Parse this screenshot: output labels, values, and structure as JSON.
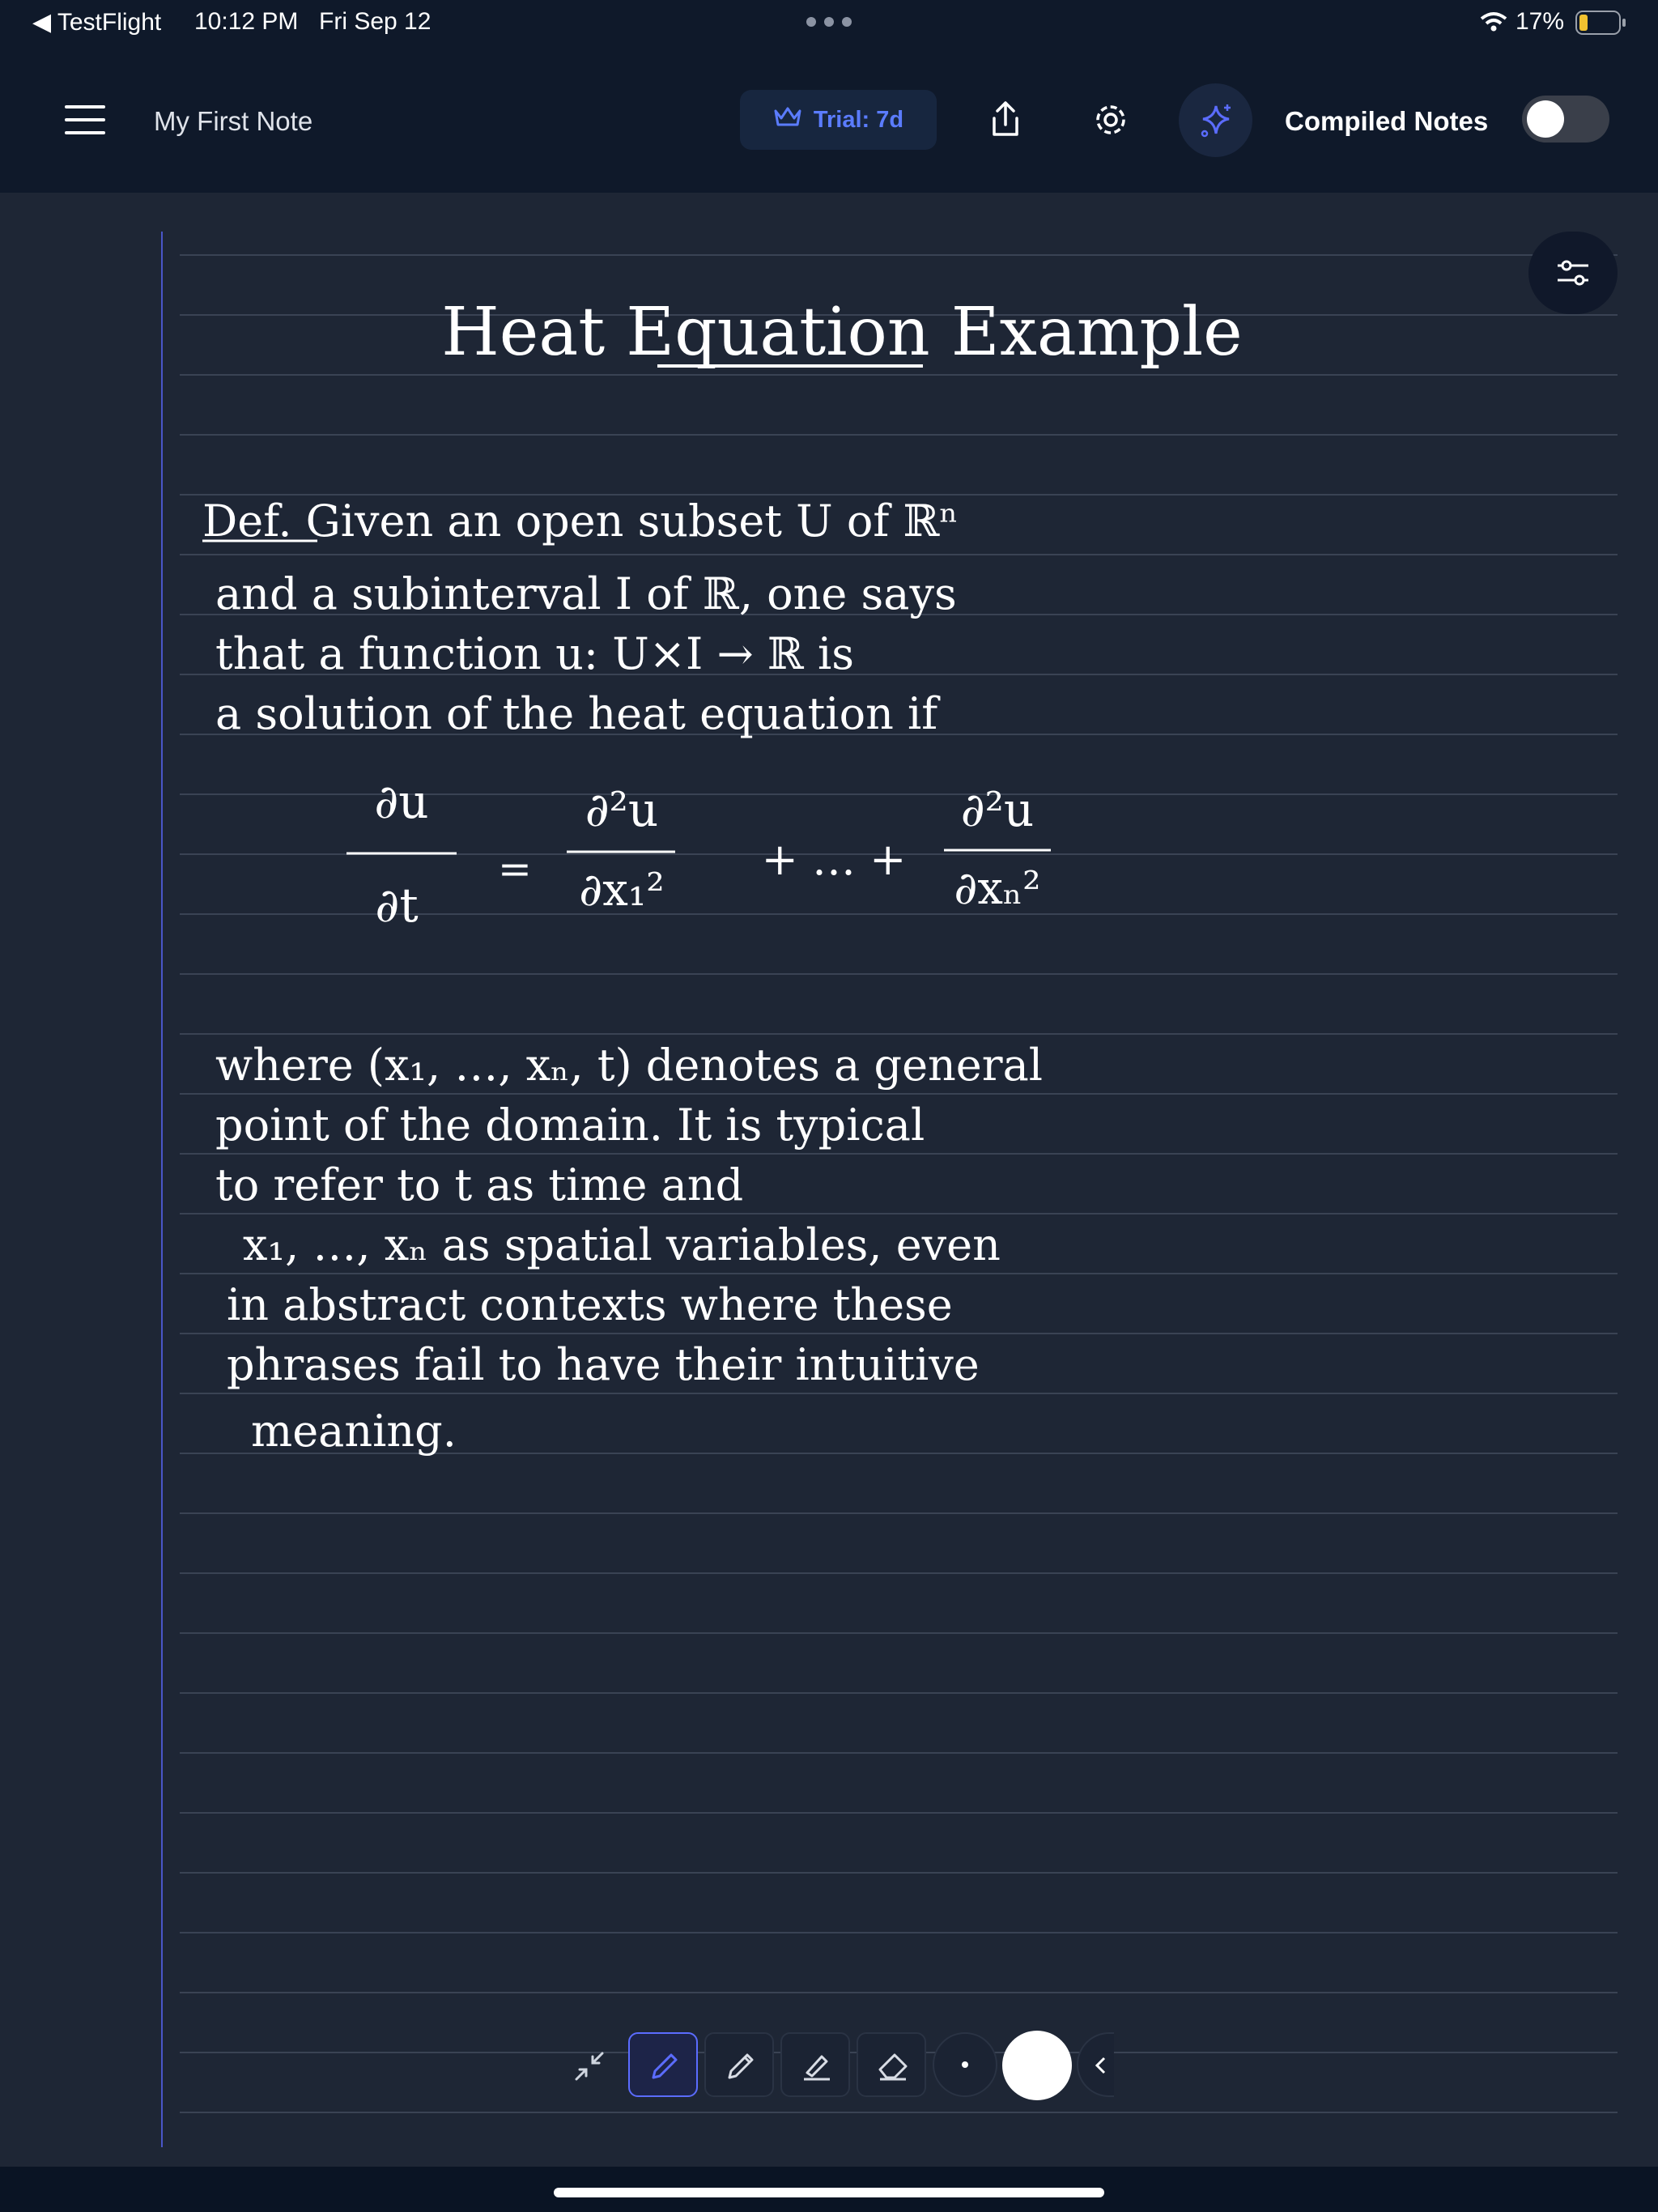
{
  "status_bar": {
    "back_app": "◀ TestFlight",
    "time": "10:12 PM",
    "date": "Fri Sep 12",
    "battery": "17%"
  },
  "header": {
    "note_title": "My First Note",
    "trial_label": "Trial: 7d",
    "compiled_label": "Compiled Notes",
    "compiled_enabled": false
  },
  "note": {
    "title": "Heat Equation Example",
    "lines": [
      "Def. Given an open subset U of ℝⁿ",
      "and a subinterval I of ℝ, one says",
      "that a function u: U×I → ℝ is",
      "a solution of the heat equation if",
      "where (x₁, …, xₙ, t) denotes a general",
      "point of the domain. It is typical",
      "to refer to t as time and",
      "x₁, …, xₙ as spatial variables, even",
      "in abstract contexts where these",
      "phrases fail to have their intuitive",
      "meaning."
    ],
    "equation": {
      "lhs_num": "∂u",
      "lhs_den": "∂t",
      "eq": "=",
      "t1_num": "∂²u",
      "t1_den": "∂x₁²",
      "plus_dots": "+ … +",
      "t2_num": "∂²u",
      "t2_den": "∂xₙ²"
    }
  },
  "colors": {
    "accent": "#5b6cff",
    "margin_line": "#4a56c8",
    "canvas": "#1e2635",
    "header": "#0f192a"
  }
}
